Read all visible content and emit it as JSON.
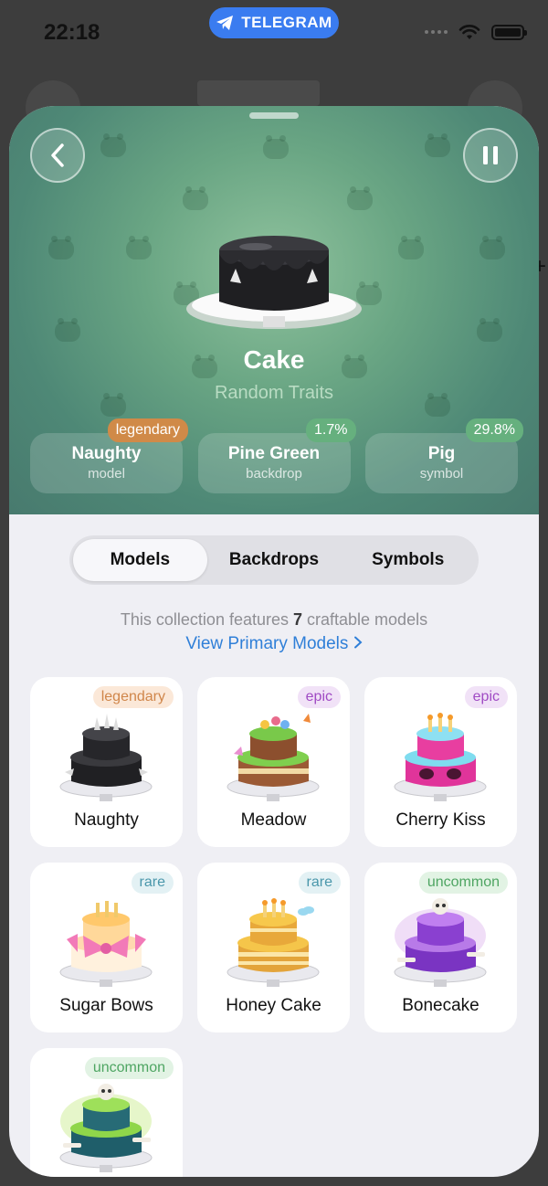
{
  "status_bar": {
    "time": "22:18",
    "app_pill": "TELEGRAM"
  },
  "gift": {
    "title": "Cake",
    "subtitle": "Random Traits",
    "traits": [
      {
        "name": "Naughty",
        "type": "model",
        "badge": "legendary"
      },
      {
        "name": "Pine Green",
        "type": "backdrop",
        "badge": "1.7%"
      },
      {
        "name": "Pig",
        "type": "symbol",
        "badge": "29.8%"
      }
    ]
  },
  "tabs": [
    "Models",
    "Backdrops",
    "Symbols"
  ],
  "active_tab": "Models",
  "collection_info": {
    "before": "This collection features ",
    "count": "7",
    "after": " craftable models"
  },
  "view_link": "View Primary Models",
  "models": [
    {
      "name": "Naughty",
      "rarity": "legendary"
    },
    {
      "name": "Meadow",
      "rarity": "epic"
    },
    {
      "name": "Cherry Kiss",
      "rarity": "epic"
    },
    {
      "name": "Sugar Bows",
      "rarity": "rare"
    },
    {
      "name": "Honey Cake",
      "rarity": "rare"
    },
    {
      "name": "Bonecake",
      "rarity": "uncommon"
    },
    {
      "name": "",
      "rarity": "uncommon"
    }
  ],
  "colors": {
    "accent_link": "#2f7fd8",
    "telegram_pill": "#3a7cf0",
    "hero_backdrop": "#6aa684",
    "legendary": "#d08a48",
    "epic": "#a04bc4",
    "rare": "#4a97ab",
    "uncommon": "#4ea562"
  },
  "icons": {
    "back": "chevron-left-icon",
    "pause": "pause-icon",
    "link_chevron": "chevron-right-icon",
    "telegram": "telegram-plane-icon"
  }
}
